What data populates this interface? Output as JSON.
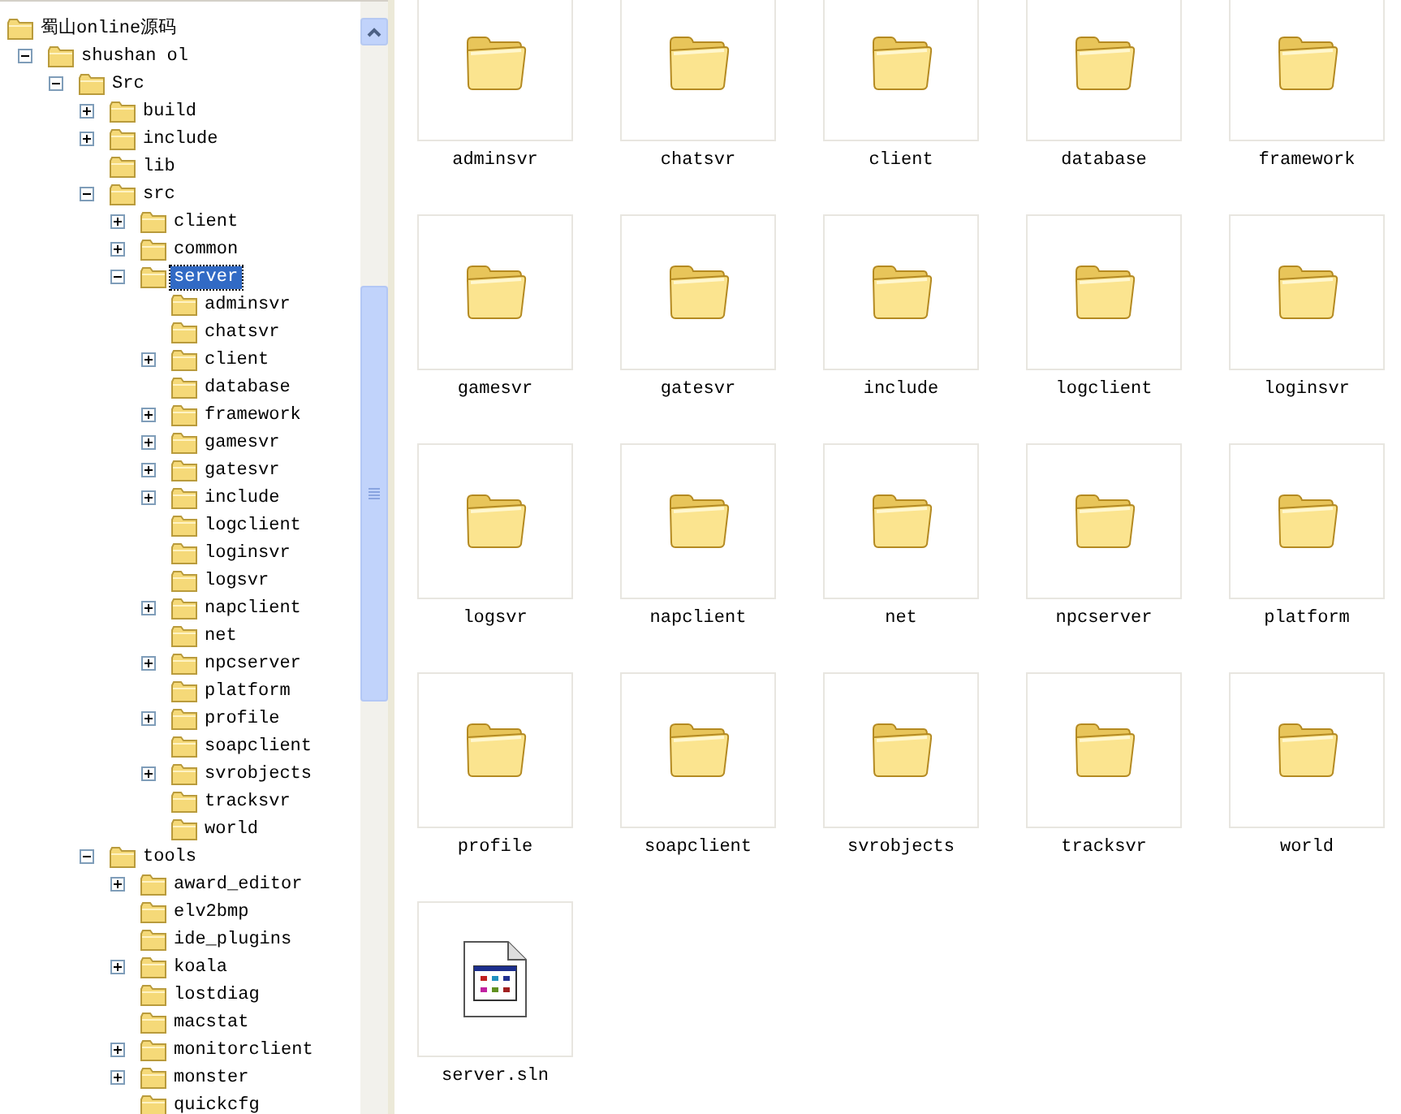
{
  "folder_tree": {
    "items": [
      {
        "label": "蜀山online源码",
        "selected": false,
        "children": [
          {
            "label": "shushan ol",
            "expandable": true,
            "expanded": true,
            "selected": false,
            "children": [
              {
                "label": "Src",
                "expandable": true,
                "expanded": true,
                "selected": false,
                "children": [
                  {
                    "label": "build",
                    "expandable": true,
                    "expanded": false,
                    "selected": false
                  },
                  {
                    "label": "include",
                    "expandable": true,
                    "expanded": false,
                    "selected": false
                  },
                  {
                    "label": "lib",
                    "expandable": false,
                    "selected": false
                  },
                  {
                    "label": "src",
                    "expandable": true,
                    "expanded": true,
                    "selected": false,
                    "children": [
                      {
                        "label": "client",
                        "expandable": true,
                        "expanded": false,
                        "selected": false
                      },
                      {
                        "label": "common",
                        "expandable": true,
                        "expanded": false,
                        "selected": false
                      },
                      {
                        "label": "server",
                        "expandable": true,
                        "expanded": true,
                        "selected": true,
                        "children": [
                          {
                            "label": "adminsvr",
                            "expandable": false,
                            "selected": false
                          },
                          {
                            "label": "chatsvr",
                            "expandable": false,
                            "selected": false
                          },
                          {
                            "label": "client",
                            "expandable": true,
                            "expanded": false,
                            "selected": false
                          },
                          {
                            "label": "database",
                            "expandable": false,
                            "selected": false
                          },
                          {
                            "label": "framework",
                            "expandable": true,
                            "expanded": false,
                            "selected": false
                          },
                          {
                            "label": "gamesvr",
                            "expandable": true,
                            "expanded": false,
                            "selected": false
                          },
                          {
                            "label": "gatesvr",
                            "expandable": true,
                            "expanded": false,
                            "selected": false
                          },
                          {
                            "label": "include",
                            "expandable": true,
                            "expanded": false,
                            "selected": false
                          },
                          {
                            "label": "logclient",
                            "expandable": false,
                            "selected": false
                          },
                          {
                            "label": "loginsvr",
                            "expandable": false,
                            "selected": false
                          },
                          {
                            "label": "logsvr",
                            "expandable": false,
                            "selected": false
                          },
                          {
                            "label": "napclient",
                            "expandable": true,
                            "expanded": false,
                            "selected": false
                          },
                          {
                            "label": "net",
                            "expandable": false,
                            "selected": false
                          },
                          {
                            "label": "npcserver",
                            "expandable": true,
                            "expanded": false,
                            "selected": false
                          },
                          {
                            "label": "platform",
                            "expandable": false,
                            "selected": false
                          },
                          {
                            "label": "profile",
                            "expandable": true,
                            "expanded": false,
                            "selected": false
                          },
                          {
                            "label": "soapclient",
                            "expandable": false,
                            "selected": false
                          },
                          {
                            "label": "svrobjects",
                            "expandable": true,
                            "expanded": false,
                            "selected": false
                          },
                          {
                            "label": "tracksvr",
                            "expandable": false,
                            "selected": false
                          },
                          {
                            "label": "world",
                            "expandable": false,
                            "selected": false
                          }
                        ]
                      }
                    ]
                  },
                  {
                    "label": "tools",
                    "expandable": true,
                    "expanded": true,
                    "selected": false,
                    "children": [
                      {
                        "label": "award_editor",
                        "expandable": true,
                        "expanded": false,
                        "selected": false
                      },
                      {
                        "label": "elv2bmp",
                        "expandable": false,
                        "selected": false
                      },
                      {
                        "label": "ide_plugins",
                        "expandable": false,
                        "selected": false
                      },
                      {
                        "label": "koala",
                        "expandable": true,
                        "expanded": false,
                        "selected": false
                      },
                      {
                        "label": "lostdiag",
                        "expandable": false,
                        "selected": false
                      },
                      {
                        "label": "macstat",
                        "expandable": false,
                        "selected": false
                      },
                      {
                        "label": "monitorclient",
                        "expandable": true,
                        "expanded": false,
                        "selected": false
                      },
                      {
                        "label": "monster",
                        "expandable": true,
                        "expanded": false,
                        "selected": false
                      },
                      {
                        "label": "quickcfg",
                        "expandable": false,
                        "selected": false
                      }
                    ]
                  }
                ]
              }
            ]
          }
        ]
      }
    ]
  },
  "file_view": {
    "items": [
      {
        "name": "adminsvr",
        "kind": "folder"
      },
      {
        "name": "chatsvr",
        "kind": "folder"
      },
      {
        "name": "client",
        "kind": "folder"
      },
      {
        "name": "database",
        "kind": "folder"
      },
      {
        "name": "framework",
        "kind": "folder"
      },
      {
        "name": "gamesvr",
        "kind": "folder"
      },
      {
        "name": "gatesvr",
        "kind": "folder"
      },
      {
        "name": "include",
        "kind": "folder"
      },
      {
        "name": "logclient",
        "kind": "folder"
      },
      {
        "name": "loginsvr",
        "kind": "folder"
      },
      {
        "name": "logsvr",
        "kind": "folder"
      },
      {
        "name": "napclient",
        "kind": "folder"
      },
      {
        "name": "net",
        "kind": "folder"
      },
      {
        "name": "npcserver",
        "kind": "folder"
      },
      {
        "name": "platform",
        "kind": "folder"
      },
      {
        "name": "profile",
        "kind": "folder"
      },
      {
        "name": "soapclient",
        "kind": "folder"
      },
      {
        "name": "svrobjects",
        "kind": "folder"
      },
      {
        "name": "tracksvr",
        "kind": "folder"
      },
      {
        "name": "world",
        "kind": "folder"
      },
      {
        "name": "server.sln",
        "kind": "solution"
      }
    ]
  }
}
